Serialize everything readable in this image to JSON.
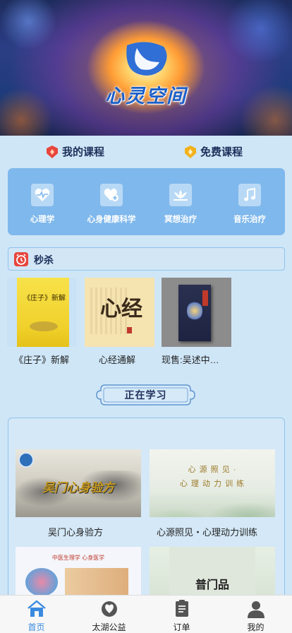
{
  "hero": {
    "title": "心灵空间"
  },
  "course_tabs": {
    "my_courses": "我的课程",
    "free_courses": "免费课程"
  },
  "categories": [
    {
      "label": "心理学",
      "icon": "heartbeat-icon"
    },
    {
      "label": "心身健康科学",
      "icon": "heart-plus-icon"
    },
    {
      "label": "冥想治疗",
      "icon": "lotus-icon"
    },
    {
      "label": "音乐治疗",
      "icon": "music-note-icon"
    }
  ],
  "flash_sale": {
    "label": "秒杀",
    "items": [
      {
        "title": "《庄子》新解",
        "cover_text": "《庄子》新解"
      },
      {
        "title": "心经通解",
        "cover_text": "心经"
      },
      {
        "title": "现售:吴述中…",
        "cover_text": ""
      }
    ]
  },
  "studying": {
    "header": "正在学习",
    "cards": [
      {
        "title": "吴门心身验方",
        "thumb_text": "吴门心身验方"
      },
      {
        "title": "心源照见・心理动力训练",
        "thumb_text_1": "心 源 照 见 ·",
        "thumb_text_2": "心 理 动 力 训 练"
      },
      {
        "title": "",
        "thumb_text": "中医生理学 心身医学"
      },
      {
        "title": "",
        "thumb_text": "普门品"
      }
    ]
  },
  "nav": [
    {
      "label": "首页",
      "icon": "home-icon",
      "active": true
    },
    {
      "label": "太湖公益",
      "icon": "charity-icon",
      "active": false
    },
    {
      "label": "订单",
      "icon": "order-icon",
      "active": false
    },
    {
      "label": "我的",
      "icon": "user-icon",
      "active": false
    }
  ],
  "colors": {
    "accent": "#3a8be0",
    "panel": "#7fb8ec",
    "background": "#cfe6f7"
  }
}
